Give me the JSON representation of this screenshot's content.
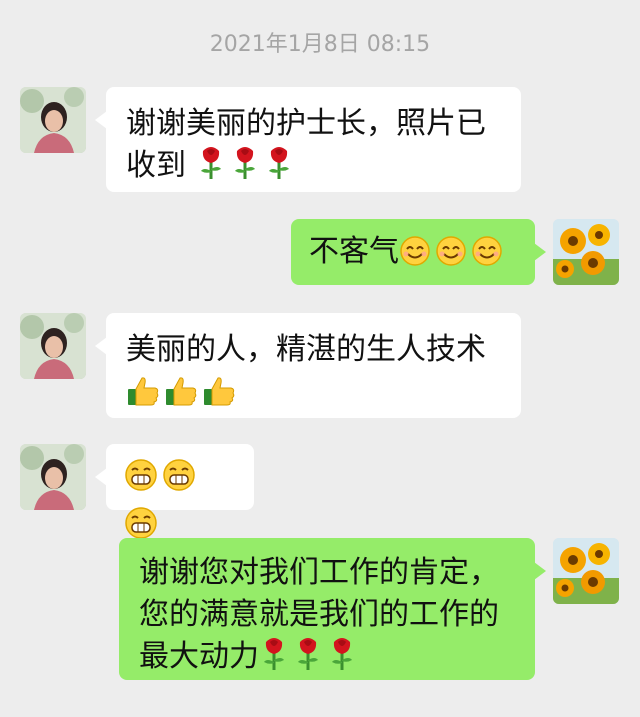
{
  "chat": {
    "timestamp": "2021年1月8日 08:15",
    "messages": [
      {
        "side": "left",
        "text": "谢谢美丽的护士长，照片已收到",
        "emoji": [
          "rose-icon",
          "rose-icon",
          "rose-icon"
        ]
      },
      {
        "side": "right",
        "text": "不客气",
        "emoji": [
          "smile-icon",
          "smile-icon",
          "smile-icon"
        ]
      },
      {
        "side": "left",
        "text": "美丽的人，精湛的生人技术",
        "emoji": [
          "thumbs-up-icon",
          "thumbs-up-icon",
          "thumbs-up-icon"
        ]
      },
      {
        "side": "left",
        "text": "",
        "emoji": [
          "grin-icon",
          "grin-icon",
          "grin-icon"
        ]
      },
      {
        "side": "right",
        "text": "谢谢您对我们工作的肯定，您的满意就是我们的工作的最大动力",
        "emoji": [
          "rose-icon",
          "rose-icon",
          "rose-icon"
        ]
      }
    ]
  },
  "colors": {
    "background": "#ededed",
    "incoming_bubble": "#ffffff",
    "outgoing_bubble": "#95ec69",
    "timestamp_text": "#a5a5a5"
  }
}
